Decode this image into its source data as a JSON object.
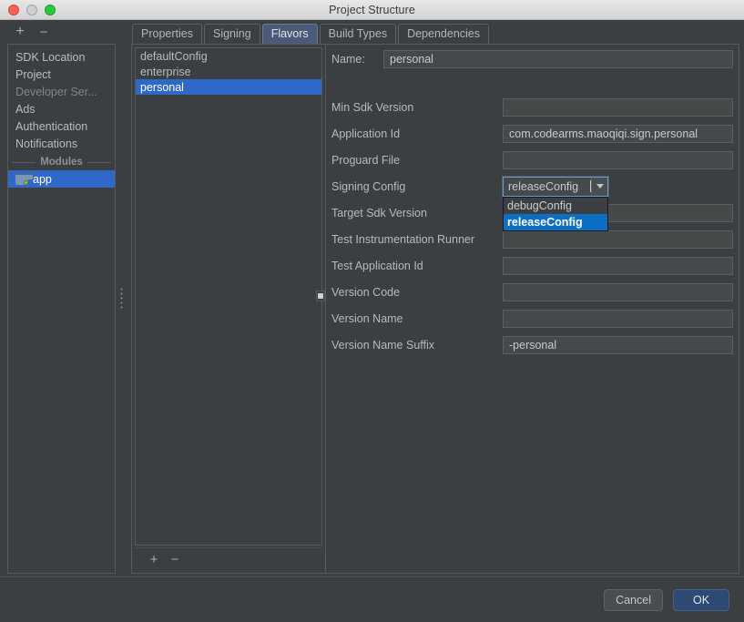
{
  "window": {
    "title": "Project Structure",
    "traffic_lights": [
      "close-red",
      "minimize-gray",
      "zoom-green"
    ]
  },
  "left_toolbar": {
    "add_label": "+",
    "remove_label": "−"
  },
  "sidebar": {
    "items": [
      {
        "label": "SDK Location",
        "state": "normal"
      },
      {
        "label": "Project",
        "state": "normal"
      },
      {
        "label": "Developer Ser...",
        "state": "muted"
      },
      {
        "label": "Ads",
        "state": "normal"
      },
      {
        "label": "Authentication",
        "state": "normal"
      },
      {
        "label": "Notifications",
        "state": "normal"
      }
    ],
    "separator_label": "Modules",
    "modules": [
      {
        "label": "app",
        "state": "selected",
        "icon": "module-folder-icon"
      }
    ]
  },
  "tabs": [
    {
      "label": "Properties",
      "active": false
    },
    {
      "label": "Signing",
      "active": false
    },
    {
      "label": "Flavors",
      "active": true
    },
    {
      "label": "Build Types",
      "active": false
    },
    {
      "label": "Dependencies",
      "active": false
    }
  ],
  "flavors_panel": {
    "items": [
      {
        "label": "defaultConfig",
        "selected": false
      },
      {
        "label": "enterprise",
        "selected": false
      },
      {
        "label": "personal",
        "selected": true
      }
    ],
    "add_label": "+",
    "remove_label": "−"
  },
  "form": {
    "name_label": "Name:",
    "name_value": "personal",
    "fields": [
      {
        "label": "Min Sdk Version",
        "value": "",
        "type": "text"
      },
      {
        "label": "Application Id",
        "value": "com.codearms.maoqiqi.sign.personal",
        "type": "text"
      },
      {
        "label": "Proguard File",
        "value": "",
        "type": "text"
      },
      {
        "label": "Signing Config",
        "value": "releaseConfig",
        "type": "combo"
      },
      {
        "label": "Target Sdk Version",
        "value": "",
        "type": "text"
      },
      {
        "label": "Test Instrumentation Runner",
        "value": "",
        "type": "text"
      },
      {
        "label": "Test Application Id",
        "value": "",
        "type": "text"
      },
      {
        "label": "Version Code",
        "value": "",
        "type": "text"
      },
      {
        "label": "Version Name",
        "value": "",
        "type": "text"
      },
      {
        "label": "Version Name Suffix",
        "value": "-personal",
        "type": "text"
      }
    ],
    "signing_config_dropdown": {
      "open": true,
      "options": [
        {
          "label": "debugConfig",
          "selected": false
        },
        {
          "label": "releaseConfig",
          "selected": true
        }
      ]
    }
  },
  "footer": {
    "cancel_label": "Cancel",
    "ok_label": "OK"
  },
  "colors": {
    "window_bg": "#3c3f41",
    "selection_blue": "#3068c8",
    "dropdown_highlight": "#0d6fc4",
    "active_tab": "#4a5a78",
    "primary_button": "#2e4a72",
    "field_bg": "#45494a",
    "text": "#bbbbbb"
  }
}
